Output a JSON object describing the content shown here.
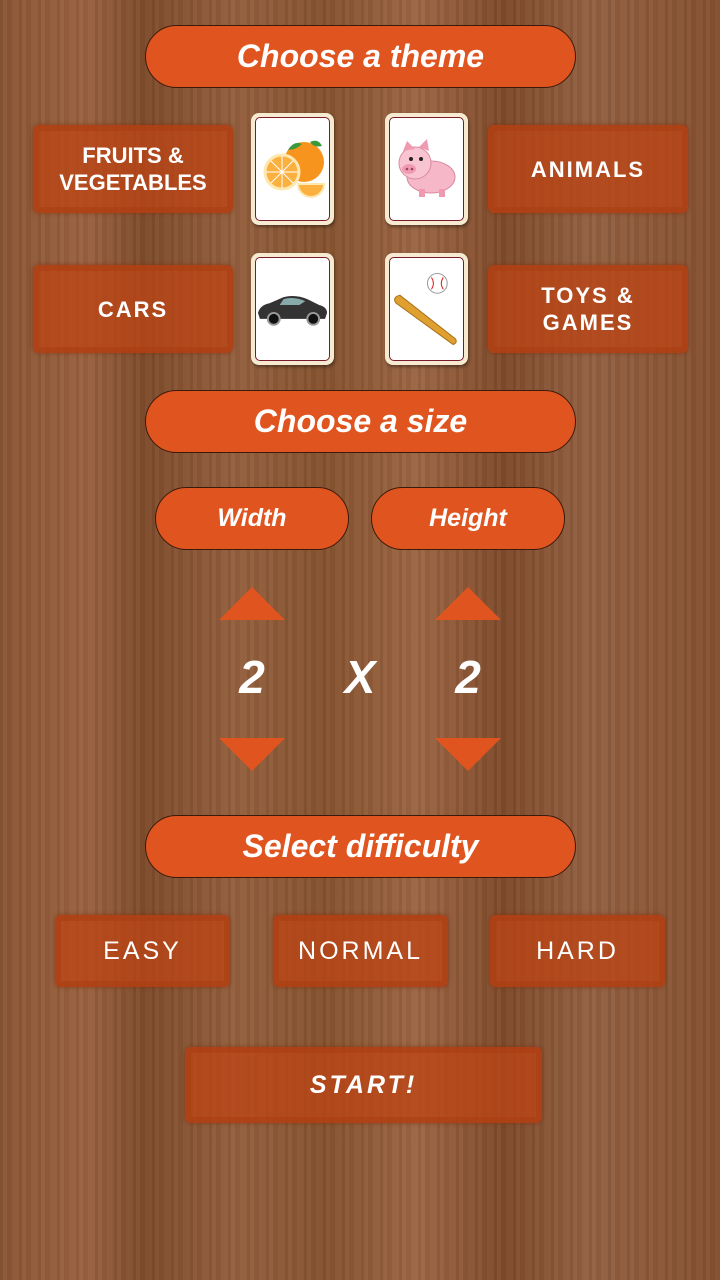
{
  "theme": {
    "title": "Choose a theme",
    "options": [
      {
        "label": "FRUITS & VEGETABLES",
        "icon": "orange-icon"
      },
      {
        "label": "ANIMALS",
        "icon": "pig-icon"
      },
      {
        "label": "CARS",
        "icon": "car-icon"
      },
      {
        "label": "TOYS & GAMES",
        "icon": "baseball-bat-icon"
      }
    ]
  },
  "size": {
    "title": "Choose a size",
    "width_label": "Width",
    "height_label": "Height",
    "width": "2",
    "separator": "X",
    "height": "2"
  },
  "difficulty": {
    "title": "Select difficulty",
    "options": [
      "EASY",
      "NORMAL",
      "HARD"
    ]
  },
  "start_label": "START!",
  "colors": {
    "accent": "#e0541f",
    "tile": "#be4414"
  }
}
